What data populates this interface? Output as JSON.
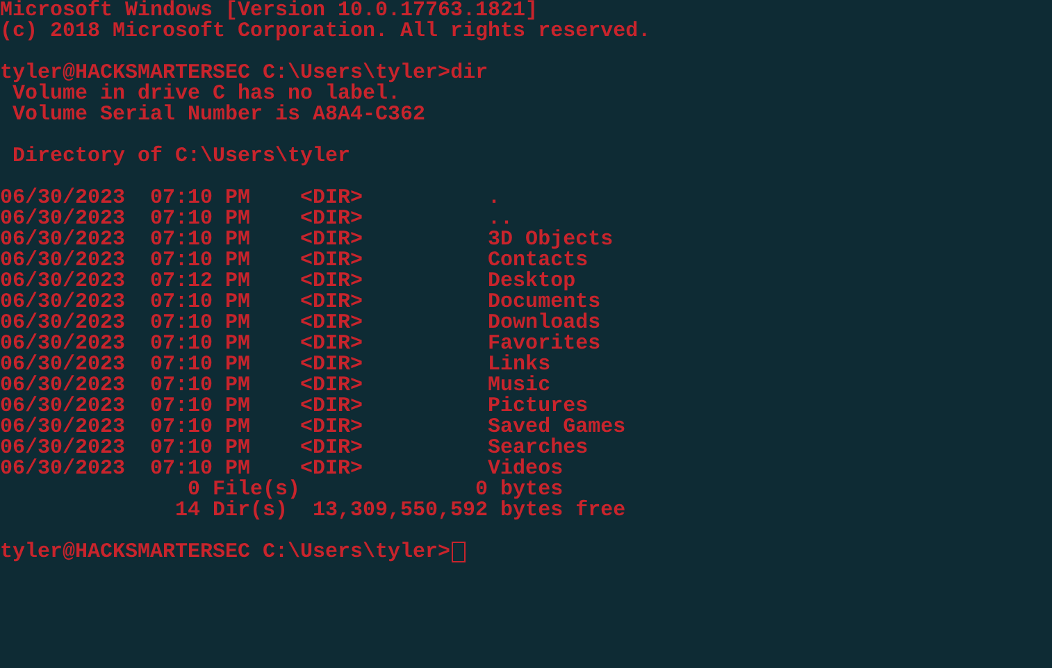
{
  "console": {
    "lines": [
      {
        "kind": "output",
        "text": "Microsoft Windows [Version 10.0.17763.1821]"
      },
      {
        "kind": "output",
        "text": "(c) 2018 Microsoft Corporation. All rights reserved."
      },
      {
        "kind": "blank"
      },
      {
        "kind": "prompt",
        "prompt": "tyler@HACKSMARTERSEC C:\\Users\\tyler>",
        "command": "dir"
      },
      {
        "kind": "output",
        "text": " Volume in drive C has no label."
      },
      {
        "kind": "output",
        "text": " Volume Serial Number is A8A4-C362"
      },
      {
        "kind": "blank"
      },
      {
        "kind": "output",
        "text": " Directory of C:\\Users\\tyler"
      },
      {
        "kind": "blank"
      },
      {
        "kind": "output",
        "text": "06/30/2023  07:10 PM    <DIR>          ."
      },
      {
        "kind": "output",
        "text": "06/30/2023  07:10 PM    <DIR>          .."
      },
      {
        "kind": "output",
        "text": "06/30/2023  07:10 PM    <DIR>          3D Objects"
      },
      {
        "kind": "output",
        "text": "06/30/2023  07:10 PM    <DIR>          Contacts"
      },
      {
        "kind": "output",
        "text": "06/30/2023  07:12 PM    <DIR>          Desktop"
      },
      {
        "kind": "output",
        "text": "06/30/2023  07:10 PM    <DIR>          Documents"
      },
      {
        "kind": "output",
        "text": "06/30/2023  07:10 PM    <DIR>          Downloads"
      },
      {
        "kind": "output",
        "text": "06/30/2023  07:10 PM    <DIR>          Favorites"
      },
      {
        "kind": "output",
        "text": "06/30/2023  07:10 PM    <DIR>          Links"
      },
      {
        "kind": "output",
        "text": "06/30/2023  07:10 PM    <DIR>          Music"
      },
      {
        "kind": "output",
        "text": "06/30/2023  07:10 PM    <DIR>          Pictures"
      },
      {
        "kind": "output",
        "text": "06/30/2023  07:10 PM    <DIR>          Saved Games"
      },
      {
        "kind": "output",
        "text": "06/30/2023  07:10 PM    <DIR>          Searches"
      },
      {
        "kind": "output",
        "text": "06/30/2023  07:10 PM    <DIR>          Videos"
      },
      {
        "kind": "output",
        "text": "               0 File(s)              0 bytes"
      },
      {
        "kind": "output",
        "text": "              14 Dir(s)  13,309,550,592 bytes free"
      },
      {
        "kind": "blank"
      },
      {
        "kind": "prompt",
        "prompt": "tyler@HACKSMARTERSEC C:\\Users\\tyler>",
        "cursor": true
      }
    ]
  }
}
